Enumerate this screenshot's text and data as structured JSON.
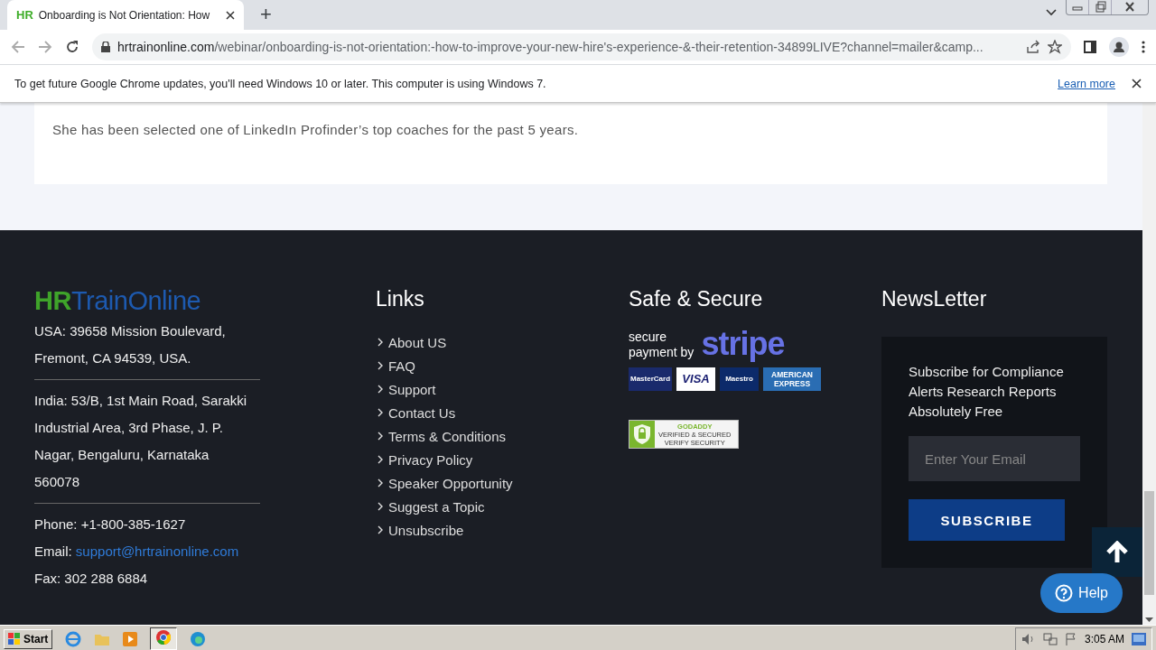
{
  "browser": {
    "tab": {
      "favicon": "HR",
      "title": "Onboarding is Not Orientation: How",
      "selected": true
    },
    "new_tab": "+",
    "url": {
      "host": "hrtrainonline.com",
      "path": "/webinar/onboarding-is-not-orientation:-how-to-improve-your-new-hire's-experience-&-their-retention-34899LIVE?channel=mailer&camp..."
    },
    "infobar": {
      "message": "To get future Google Chrome updates, you'll need Windows 10 or later. This computer is using Windows 7.",
      "link": "Learn more"
    }
  },
  "bio": {
    "text": "She has been selected one of LinkedIn Profinder’s top coaches for the past 5 years."
  },
  "footer": {
    "logo": {
      "part_1": "HR",
      "part_2": "TrainOnline"
    },
    "addresses": [
      {
        "lines": [
          "USA: 39658 Mission Boulevard,",
          "Fremont, CA 94539, USA."
        ]
      },
      {
        "lines": [
          "India: 53/B, 1st Main Road, Sarakki",
          "Industrial Area, 3rd Phase, J. P.",
          "Nagar, Bengaluru, Karnataka",
          "560078"
        ]
      }
    ],
    "phone": "Phone: +1-800-385-1627",
    "email_label": "Email:",
    "email": "support@hrtrainonline.com",
    "fax": "Fax: 302 288 6884",
    "links": {
      "title": "Links",
      "items": [
        "About US",
        "FAQ",
        "Support",
        "Contact Us",
        "Terms & Conditions",
        "Privacy Policy",
        "Speaker Opportunity",
        "Suggest a Topic",
        "Unsubscribe"
      ]
    },
    "secure": {
      "title": "Safe & Secure",
      "stripe_caption": [
        "secure",
        "payment by"
      ],
      "stripe": "stripe",
      "cards": [
        {
          "kind": "mastercard",
          "label": "MasterCard"
        },
        {
          "kind": "visa",
          "label": "VISA"
        },
        {
          "kind": "maestro",
          "label": "Maestro"
        },
        {
          "kind": "amex",
          "label": "AMERICAN EXPRESS"
        }
      ],
      "seal": {
        "brand": "GODADDY",
        "line_1": "VERIFIED & SECURED",
        "line_2": "VERIFY SECURITY"
      }
    },
    "newsletter": {
      "title": "NewsLetter",
      "text": "Subscribe for Compliance Alerts Research Reports Absolutely Free",
      "placeholder": "Enter Your Email",
      "button": "SUBSCRIBE"
    },
    "help": "Help"
  },
  "taskbar": {
    "start": "Start",
    "time": "3:05 AM"
  }
}
